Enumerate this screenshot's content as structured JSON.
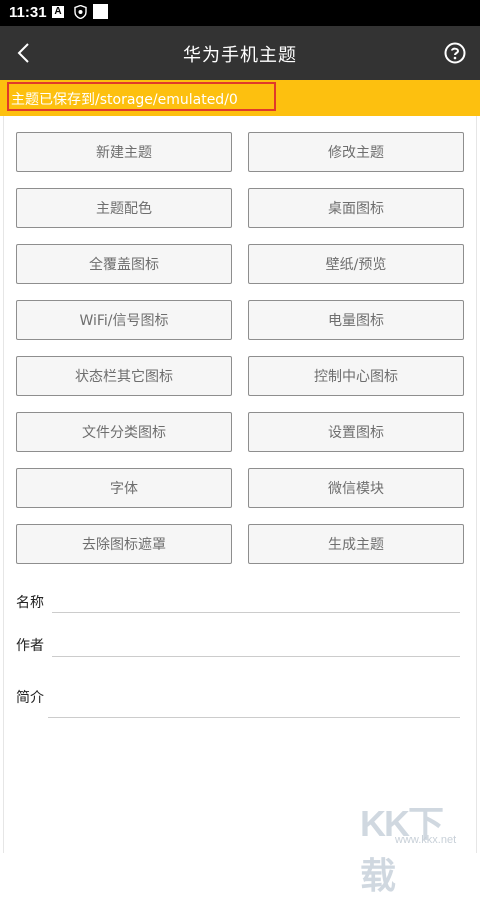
{
  "status_bar": {
    "time": "11:31",
    "notif_letter": "A"
  },
  "app_bar": {
    "title": "华为手机主题"
  },
  "notice": {
    "text": "主题已保存到/storage/emulated/0"
  },
  "buttons": [
    {
      "label": "新建主题"
    },
    {
      "label": "修改主题"
    },
    {
      "label": "主题配色"
    },
    {
      "label": "桌面图标"
    },
    {
      "label": "全覆盖图标"
    },
    {
      "label": "壁纸/预览"
    },
    {
      "label": "WiFi/信号图标"
    },
    {
      "label": "电量图标"
    },
    {
      "label": "状态栏其它图标"
    },
    {
      "label": "控制中心图标"
    },
    {
      "label": "文件分类图标"
    },
    {
      "label": "设置图标"
    },
    {
      "label": "字体"
    },
    {
      "label": "微信模块"
    },
    {
      "label": "去除图标遮罩"
    },
    {
      "label": "生成主题"
    }
  ],
  "form": {
    "name_label": "名称",
    "author_label": "作者",
    "intro_label": "简介"
  },
  "watermark": {
    "brand": "KK下载",
    "url": "www.kkx.net"
  },
  "colors": {
    "accent_bar": "#fdc00f",
    "app_bar": "#333333",
    "highlight_border": "#e03a2a"
  }
}
